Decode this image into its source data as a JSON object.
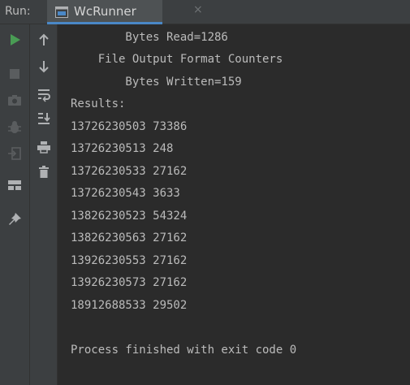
{
  "header": {
    "run_label": "Run:",
    "tab_label": "WcRunner",
    "tab_close": "×"
  },
  "toolbar_outer": [
    {
      "name": "rerun-icon",
      "color": "#499c54"
    },
    {
      "name": "stop-icon",
      "color": "#5a5d5f"
    },
    {
      "name": "screenshot-icon",
      "color": "#5a5d5f"
    },
    {
      "name": "debug-icon",
      "color": "#5a5d5f"
    },
    {
      "name": "exit-icon",
      "color": "#5a5d5f"
    },
    {
      "name": "layout-icon",
      "color": "#afb1b3"
    },
    {
      "name": "pin-icon",
      "color": "#afb1b3"
    }
  ],
  "toolbar_inner": [
    {
      "name": "scroll-up-icon"
    },
    {
      "name": "scroll-down-icon"
    },
    {
      "name": "soft-wrap-icon"
    },
    {
      "name": "scroll-to-end-icon"
    },
    {
      "name": "print-icon"
    },
    {
      "name": "trash-icon"
    }
  ],
  "console": {
    "lines": [
      "        Bytes Read=1286",
      "    File Output Format Counters",
      "        Bytes Written=159",
      "Results:",
      "13726230503 73386",
      "13726230513 248",
      "13726230533 27162",
      "13726230543 3633",
      "13826230523 54324",
      "13826230563 27162",
      "13926230553 27162",
      "13926230573 27162",
      "18912688533 29502",
      "",
      "Process finished with exit code 0"
    ]
  },
  "colors": {
    "text": "#bbbbbb",
    "background": "#2b2b2b",
    "panel": "#3c3f41",
    "accent": "#4a88c7",
    "run_green": "#499c54"
  }
}
